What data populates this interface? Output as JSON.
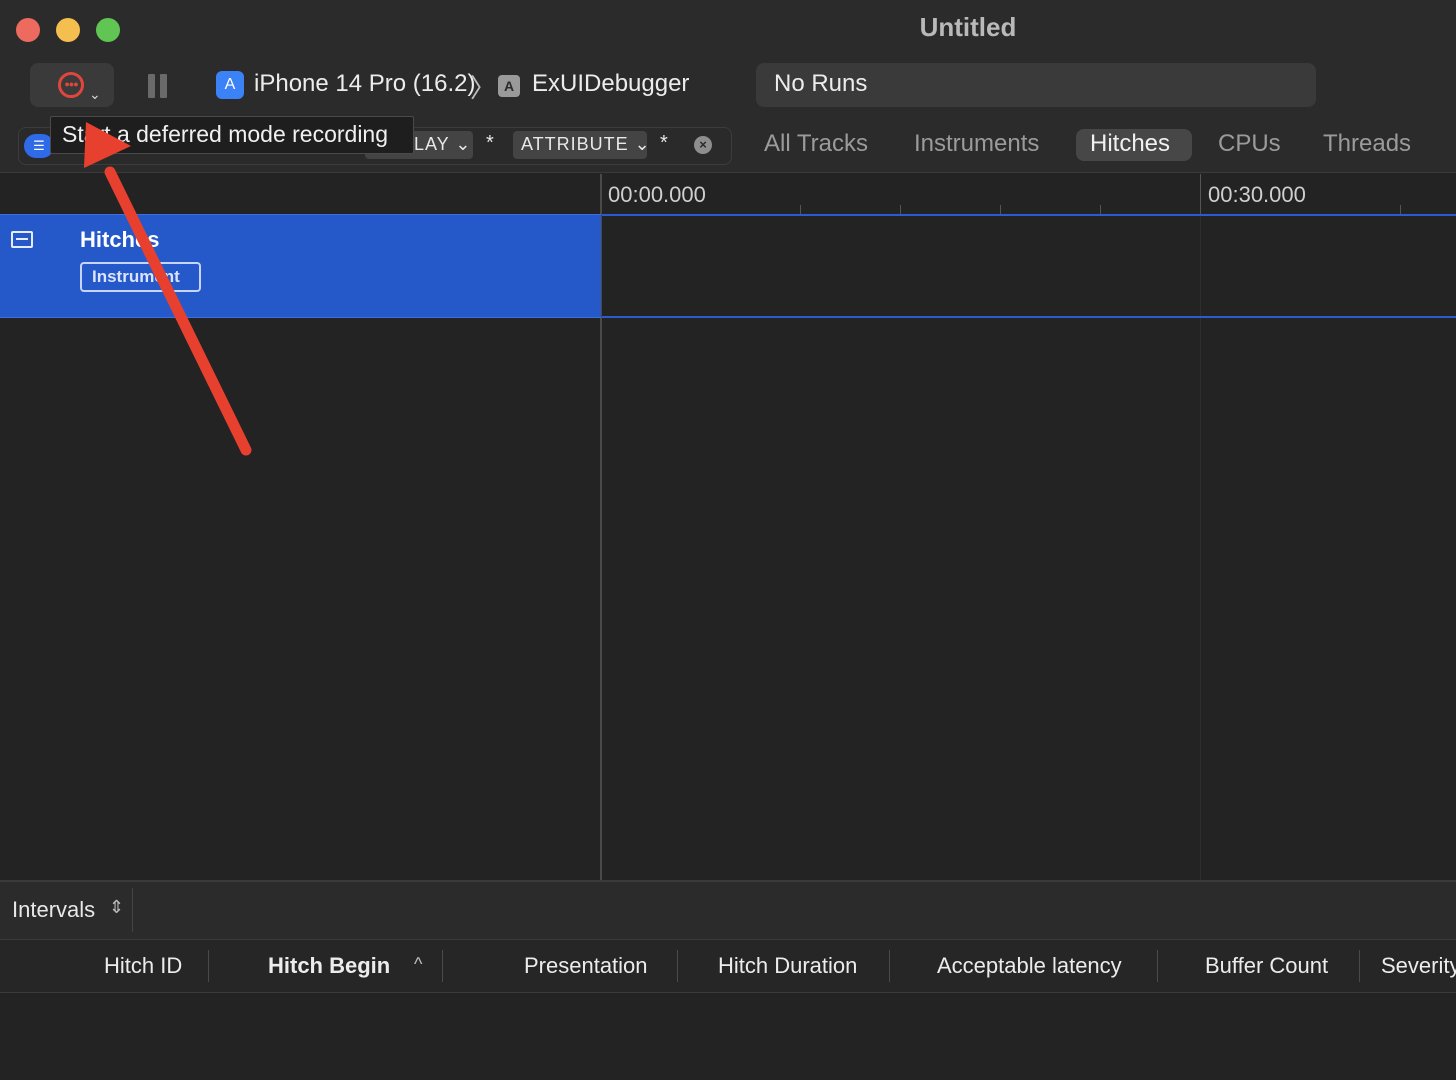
{
  "window": {
    "title": "Untitled",
    "traffic_colors": {
      "close": "#ed6a5e",
      "minimize": "#f5bf4f",
      "zoom": "#61c554"
    }
  },
  "toolbar": {
    "record_icon": "record-deferred-icon",
    "pause_icon": "pause-icon",
    "device": "iPhone 14 Pro (16.2)",
    "separator": "〉",
    "target": "ExUIDebugger",
    "runs": "No Runs"
  },
  "tooltip": {
    "text": "Start a deferred mode recording"
  },
  "filter": {
    "tokens": [
      {
        "label": "LAY"
      },
      {
        "label": "ATTRIBUTE"
      }
    ],
    "wildcard": "*",
    "clear_icon": "clear-icon"
  },
  "tabs": [
    {
      "label": "All Tracks",
      "active": false
    },
    {
      "label": "Instruments",
      "active": false
    },
    {
      "label": "Hitches",
      "active": true
    },
    {
      "label": "CPUs",
      "active": false
    },
    {
      "label": "Threads",
      "active": false
    }
  ],
  "timeline": {
    "labels": [
      "00:00.000",
      "00:30.000"
    ]
  },
  "track": {
    "title": "Hitches",
    "badge": "Instrument"
  },
  "bottom": {
    "mode": "Intervals",
    "columns": [
      "Hitch ID",
      "Hitch Begin",
      "Presentation",
      "Hitch Duration",
      "Acceptable latency",
      "Buffer Count",
      "Severity"
    ]
  },
  "annotation": {
    "arrow_color": "#e8402f"
  }
}
